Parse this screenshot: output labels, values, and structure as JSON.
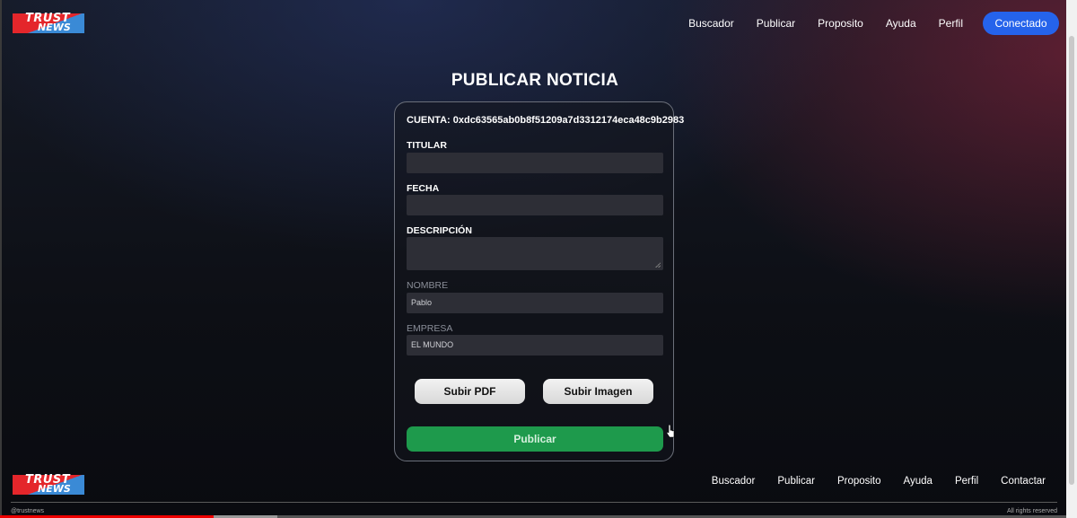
{
  "brand": {
    "line1": "TRUST",
    "line2": "NEWS"
  },
  "nav": [
    "Buscador",
    "Publicar",
    "Proposito",
    "Ayuda",
    "Perfil"
  ],
  "connect_button": "Conectado",
  "page_title": "PUBLICAR NOTICIA",
  "form": {
    "account": "CUENTA: 0xdc63565ab0b8f51209a7d3312174eca48c9b2983",
    "titular_label": "TITULAR",
    "titular_value": "",
    "fecha_label": "FECHA",
    "fecha_value": "",
    "descripcion_label": "DESCRIPCIÓN",
    "descripcion_value": "",
    "nombre_label": "NOMBRE",
    "nombre_value": "Pablo",
    "empresa_label": "EMPRESA",
    "empresa_value": "EL MUNDO",
    "upload_pdf": "Subir PDF",
    "upload_image": "Subir Imagen",
    "publish": "Publicar"
  },
  "footer": {
    "nav": [
      "Buscador",
      "Publicar",
      "Proposito",
      "Ayuda",
      "Perfil",
      "Contactar"
    ],
    "handle": "@trustnews",
    "rights": "All rights reserved"
  },
  "video_progress": {
    "played": 0.2,
    "buffered": 0.26
  },
  "colors": {
    "accent": "#2563eb",
    "publish": "#1e9a4c",
    "logo_red": "#e4262b",
    "logo_blue": "#3a8ad6"
  }
}
